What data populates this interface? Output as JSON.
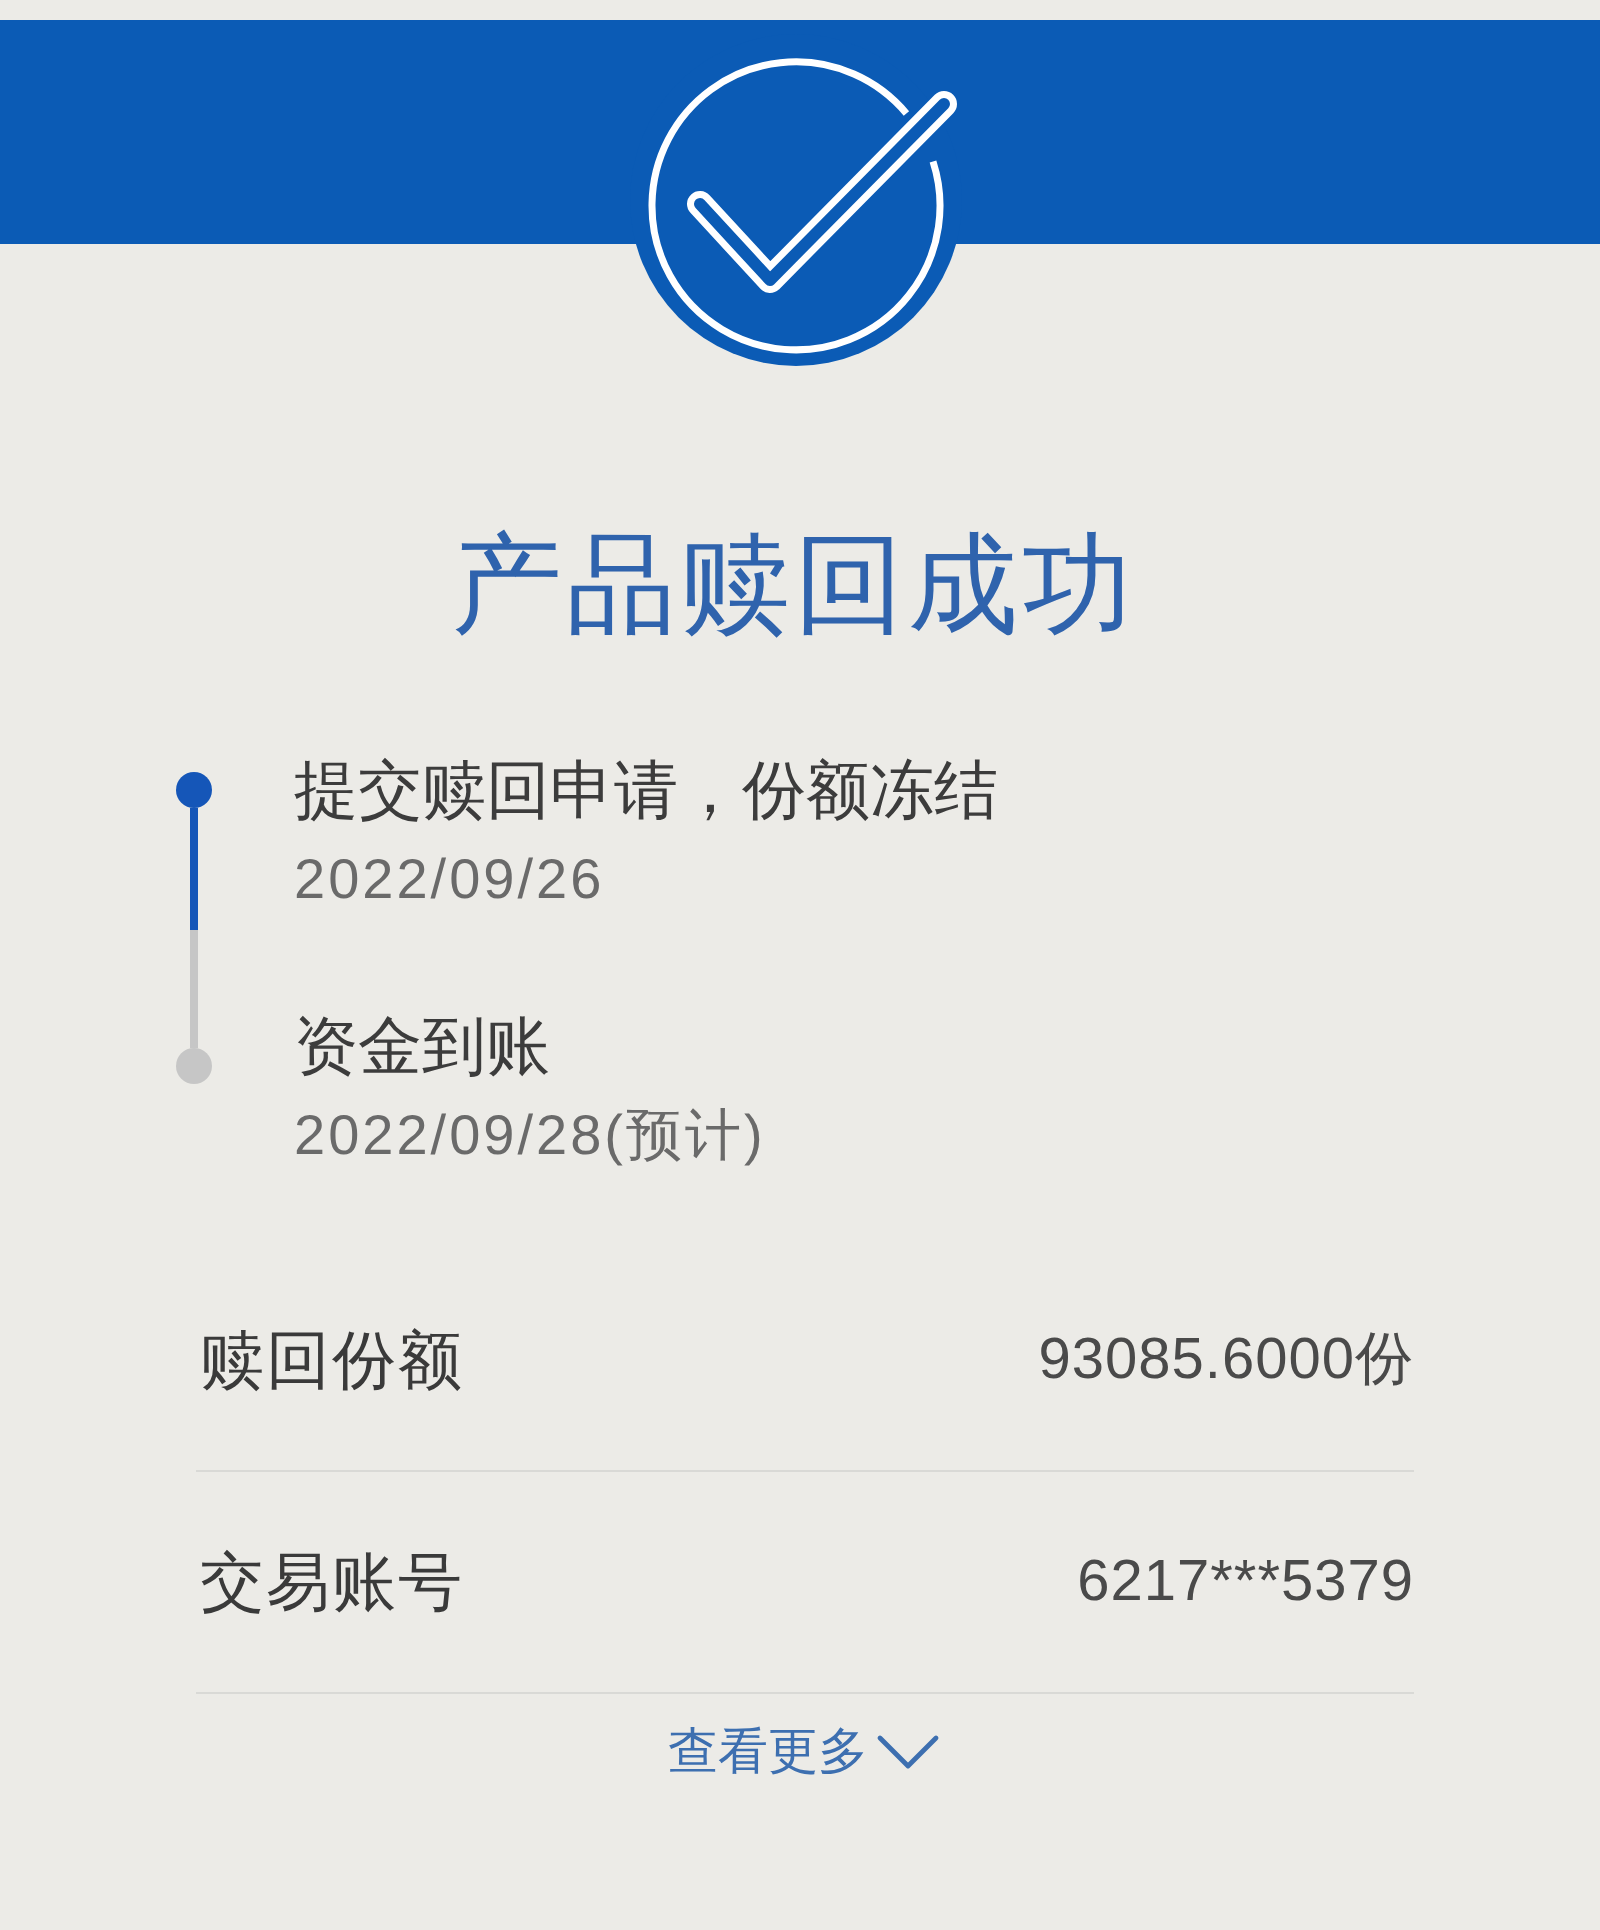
{
  "title": "产品赎回成功",
  "timeline": [
    {
      "label": "提交赎回申请，份额冻结",
      "date": "2022/09/26",
      "done": true
    },
    {
      "label": "资金到账",
      "date": "2022/09/28(预计)",
      "done": false
    }
  ],
  "details": [
    {
      "label": "赎回份额",
      "value": "93085.6000份"
    },
    {
      "label": "交易账号",
      "value": "6217***5379"
    }
  ],
  "more_link": "查看更多"
}
